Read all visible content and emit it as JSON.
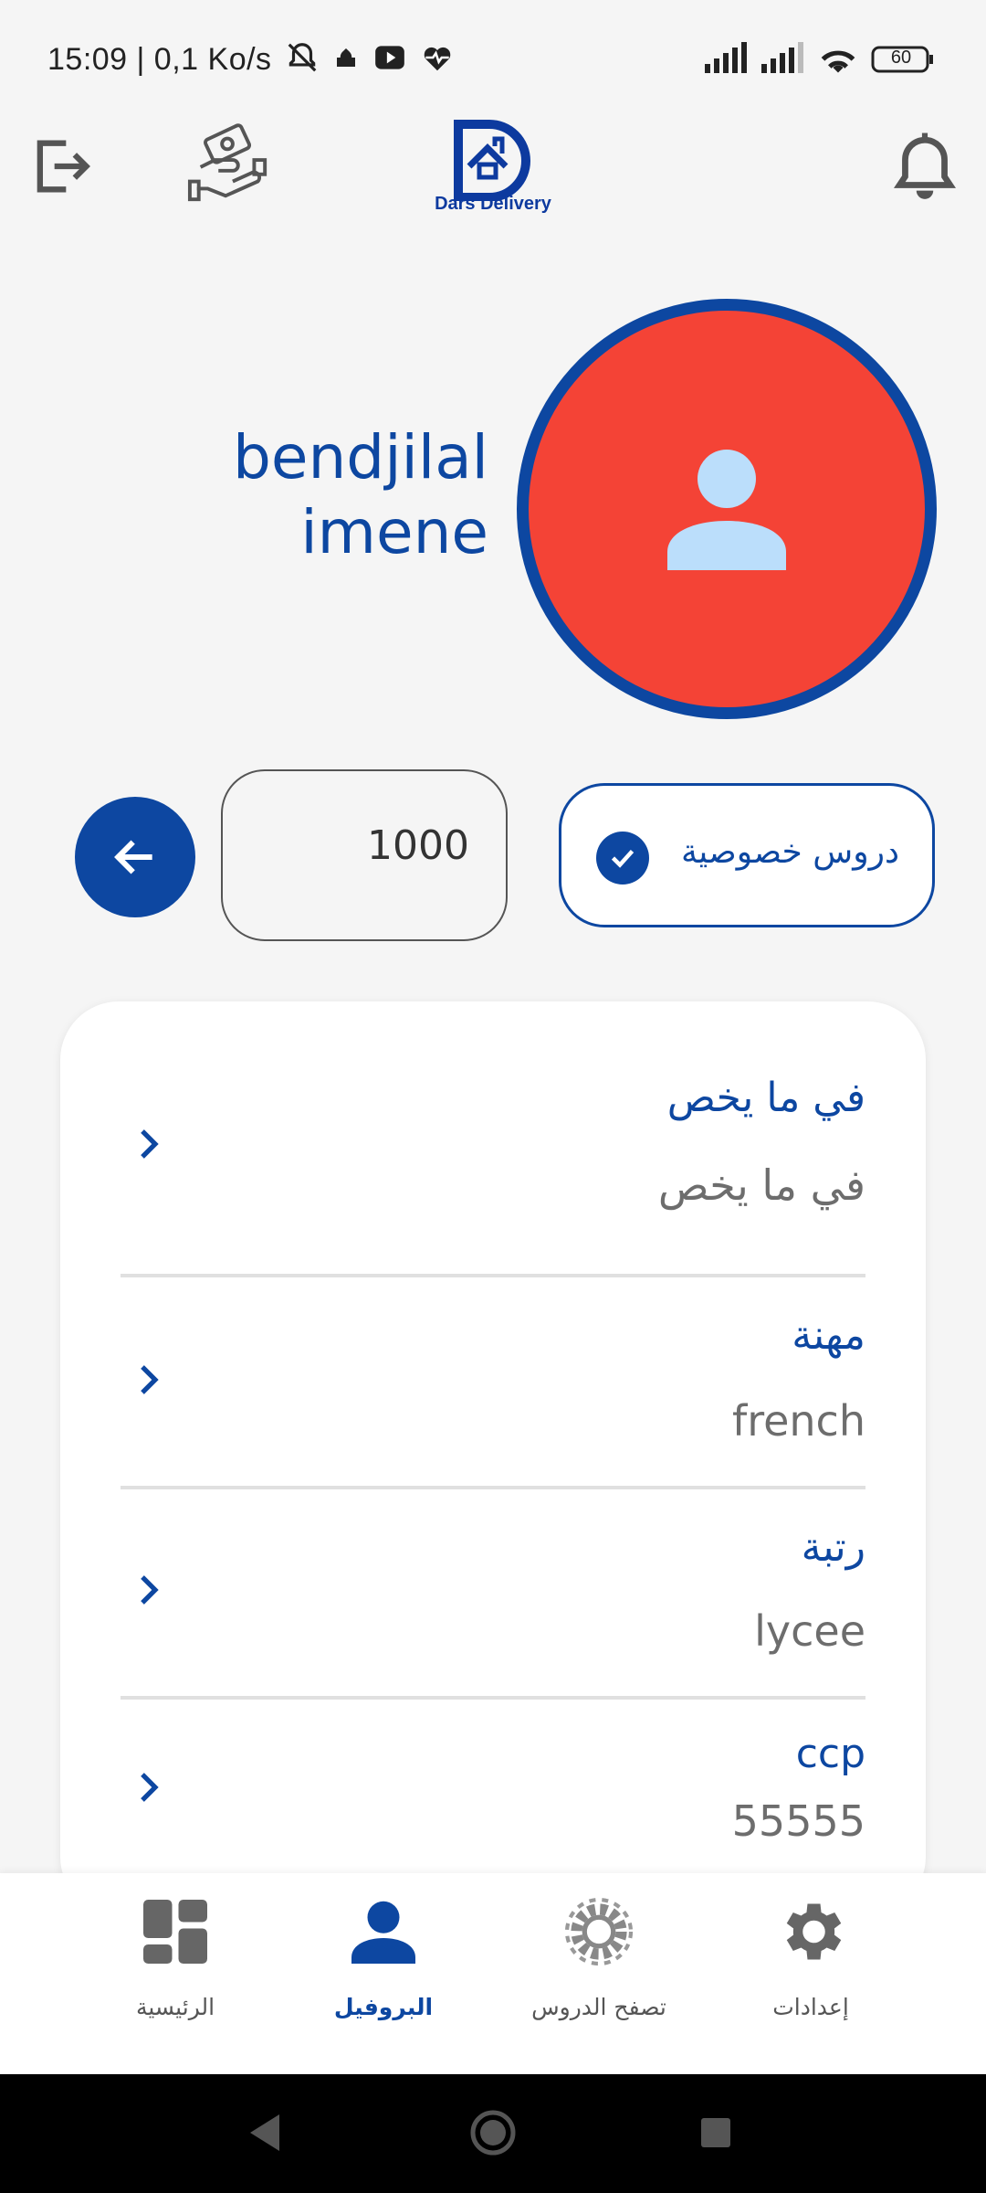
{
  "status_bar": {
    "time_speed": "15:09 | 0,1 Ko/s",
    "battery": "60",
    "icons": [
      "bell-off-icon",
      "mosque-icon",
      "youtube-icon",
      "heart-pulse-icon",
      "signal-icon",
      "signal-icon",
      "wifi-icon",
      "battery-icon"
    ]
  },
  "top_bar": {
    "logo_text": "Dars Delivery",
    "icons": [
      "logout-icon",
      "handshake-money-icon",
      "bell-icon"
    ]
  },
  "profile": {
    "first_name": "bendjilal",
    "last_name": "imene",
    "avatar_icon": "person-icon"
  },
  "actions": {
    "amount": "1000",
    "lessons_chip_label": "دروس خصوصية",
    "lessons_chip_checked": true
  },
  "info": {
    "rows": [
      {
        "title": "في ما يخص",
        "value": "في ما يخص"
      },
      {
        "title": "مهنة",
        "value": "french"
      },
      {
        "title": "رتبة",
        "value": "lycee"
      },
      {
        "title": "ccp",
        "value": "55555"
      }
    ]
  },
  "bottom_nav": {
    "items": [
      {
        "label": "الرئيسية",
        "icon": "dashboard-icon",
        "active": false
      },
      {
        "label": "البروفيل",
        "icon": "person-icon",
        "active": true
      },
      {
        "label": "تصفح الدروس",
        "icon": "cog-browse-icon",
        "active": false
      },
      {
        "label": "إعدادات",
        "icon": "settings-icon",
        "active": false
      }
    ]
  },
  "colors": {
    "primary": "#0d47a1",
    "avatar_bg": "#f44336",
    "background": "#f5f5f5"
  }
}
